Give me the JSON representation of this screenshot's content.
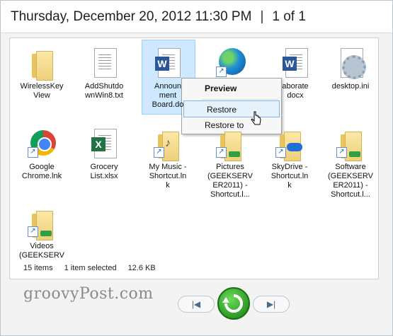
{
  "header": {
    "date_time": "Thursday, December 20, 2012 11:30 PM",
    "separator": "|",
    "page_info": "1 of 1"
  },
  "files": [
    {
      "label": "WirelessKey View",
      "icon": "folder-icon"
    },
    {
      "label": "AddShutdownWin8.txt",
      "icon": "text-file-icon"
    },
    {
      "label": "Announcement Board.docx",
      "icon": "word-document-icon"
    },
    {
      "label": "",
      "icon": "globe-icon"
    },
    {
      "label": "Collaborate.docx",
      "icon": "word-document-icon"
    },
    {
      "label": "desktop.ini",
      "icon": "settings-file-icon"
    },
    {
      "label": "Google Chrome.lnk",
      "icon": "chrome-icon"
    },
    {
      "label": "Grocery List.xlsx",
      "icon": "excel-icon"
    },
    {
      "label": "My Music - Shortcut.lnk",
      "icon": "music-folder-icon"
    },
    {
      "label": "Pictures (GEEKSERVER2011) - Shortcut.l...",
      "icon": "network-folder-icon"
    },
    {
      "label": "SkyDrive - Shortcut.lnk",
      "icon": "skydrive-folder-icon"
    },
    {
      "label": "Software (GEEKSERVER2011) - Shortcut.l...",
      "icon": "network-folder-icon"
    },
    {
      "label": "Videos (GEEKSERV",
      "icon": "network-folder-icon"
    }
  ],
  "file_labels_displayed": {
    "f0": [
      "WirelessKey",
      "View"
    ],
    "f1": [
      "AddShutdo",
      "wnWin8.txt"
    ],
    "f2": [
      "Announ",
      "ment",
      "Board.do"
    ],
    "f4": [
      "aborate",
      "docx"
    ],
    "f5": [
      "desktop.ini"
    ],
    "f6": [
      "Google",
      "Chrome.lnk"
    ],
    "f7": [
      "Grocery",
      "List.xlsx"
    ],
    "f8": [
      "My Music -",
      "Shortcut.ln",
      "k"
    ],
    "f9": [
      "Pictures",
      "(GEEKSERV",
      "ER2011) -",
      "Shortcut.l..."
    ],
    "f10": [
      "SkyDrive -",
      "Shortcut.ln",
      "k"
    ],
    "f11": [
      "Software",
      "(GEEKSERV",
      "ER2011) -",
      "Shortcut.l..."
    ],
    "f12": [
      "Videos",
      "(GEEKSERV"
    ]
  },
  "context_menu": {
    "preview": "Preview",
    "restore": "Restore",
    "restore_to": "Restore to"
  },
  "status": {
    "count": "15 items",
    "selection": "1 item selected",
    "size": "12.6 KB"
  },
  "watermark": "groovyPost.com",
  "colors": {
    "selection_bg": "#cde8ff",
    "restore_green": "#2c9a25",
    "word_blue": "#2b579a",
    "excel_green": "#217346"
  }
}
